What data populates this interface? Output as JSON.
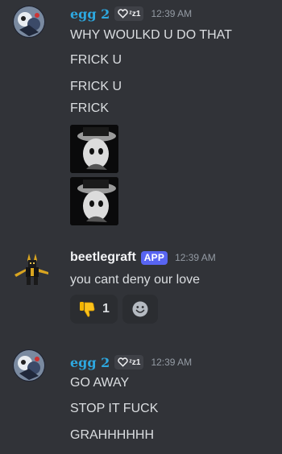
{
  "messages": [
    {
      "author": "egg 2",
      "badge": "♡ᶻᶻ",
      "time": "12:39 AM",
      "lines": [
        "WHY WOULKD U DO THAT",
        "FRICK U",
        "FRICK U",
        "FRICK"
      ],
      "images": 2
    },
    {
      "author": "beetlegraft",
      "app_tag": "APP",
      "time": "12:39 AM",
      "lines": [
        "you cant deny our love"
      ],
      "reactions": [
        {
          "emoji": "thumbs-down-icon",
          "count": "1"
        },
        {
          "emoji": "add-reaction-icon",
          "count": ""
        }
      ]
    },
    {
      "author": "egg 2",
      "badge": "♡ᶻᶻ",
      "time": "12:39 AM",
      "lines": [
        "GO AWAY",
        "STOP IT FUCK",
        "GRAHHHHHH"
      ]
    }
  ]
}
